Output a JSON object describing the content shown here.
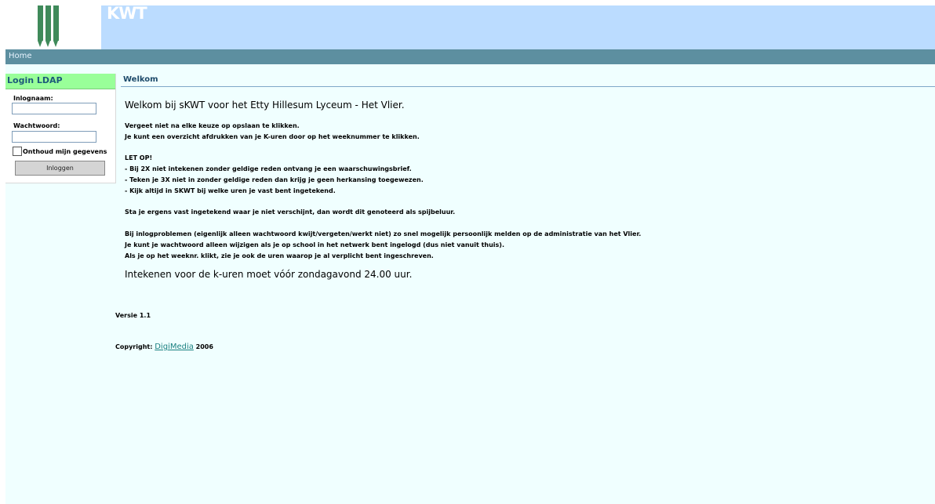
{
  "header": {
    "banner_title": "KWT",
    "logo_icon": "school-logo-icon",
    "logo_color": "#3f8a5a",
    "banner_color": "#bbdcff"
  },
  "nav": {
    "home": "Home"
  },
  "sidebar": {
    "title": "Login LDAP",
    "username_label": "Inlognaam:",
    "username_value": "",
    "password_label": "Wachtwoord:",
    "password_value": "",
    "remember_label": "Onthoud mijn gegevens",
    "remember_checked": false,
    "login_button": "Inloggen"
  },
  "main": {
    "title": "Welkom",
    "welcome": "Welkom bij sKWT voor het Etty Hillesum Lyceum - Het Vlier.",
    "intro_1": "Vergeet niet na elke keuze op opslaan te klikken.",
    "intro_2": "Je kunt een overzicht afdrukken van je K-uren door op het weeknummer te klikken.",
    "letop": "LET OP!",
    "rule_1": "- Bij 2X niet intekenen zonder geldige reden ontvang je een waarschuwingsbrief.",
    "rule_2": "- Teken je 3X niet in zonder geldige reden dan krijg je geen herkansing toegewezen.",
    "rule_3": "- Kijk altijd in SKWT bij welke uren je vast bent ingetekend.",
    "spijbel": "Sta je ergens vast ingetekend waar je niet verschijnt, dan wordt dit genoteerd als spijbeluur.",
    "problem_1": "Bij inlogproblemen (eigenlijk alleen wachtwoord kwijt/vergeten/werkt niet) zo snel mogelijk persoonlijk melden op de administratie van het Vlier.",
    "problem_2": "Je kunt je wachtwoord alleen wijzigen als je op school in het netwerk bent ingelogd (dus niet vanuit thuis).",
    "problem_3": "Als je op het weeknr. klikt, zie je ook de uren waarop je al verplicht bent ingeschreven.",
    "deadline": "Intekenen voor de k-uren moet vóór zondagavond 24.00 uur.",
    "version": "Versie 1.1",
    "copyright_prefix": "Copyright: ",
    "copyright_link": "DigiMedia",
    "copyright_year": " 2006"
  }
}
